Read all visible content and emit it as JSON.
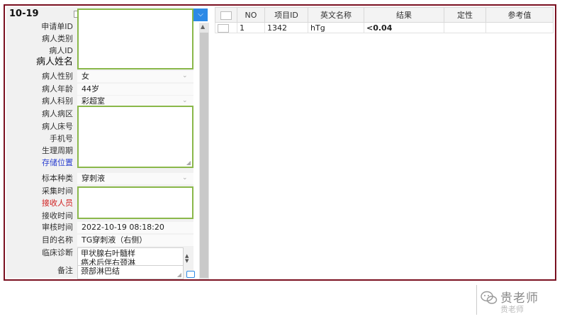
{
  "form": {
    "title": "10-19",
    "labels": {
      "request_id": "申请单ID",
      "patient_type": "病人类别",
      "patient_id": "病人ID",
      "patient_name": "病人姓名",
      "gender": "病人性别",
      "age": "病人年龄",
      "department": "病人科别",
      "ward": "病人病区",
      "bed": "病人床号",
      "phone": "手机号",
      "period": "生理周期",
      "storage": "存储位置",
      "sample_type": "标本种类",
      "collect_time": "采集时间",
      "receiver": "接收人员",
      "receive_time": "接收时间",
      "review_time": "审核时间",
      "purpose": "目的名称",
      "diagnosis": "临床诊断",
      "remark": "备注"
    },
    "values": {
      "gender": "女",
      "age": "44岁",
      "department": "彩超室",
      "sample_type": "穿刺液",
      "review_time": "2022-10-19 08:18:20",
      "purpose": "TG穿刺液（右侧）",
      "diagnosis_line1": "甲状腺右叶髓样",
      "diagnosis_line2": "癌术后伴右颈淋",
      "remark": "颈部淋巴结"
    }
  },
  "results_table": {
    "columns": [
      "NO",
      "项目ID",
      "英文名称",
      "结果",
      "定性",
      "参考值"
    ],
    "rows": [
      {
        "no": "1",
        "item_id": "1342",
        "english_name": "hTg",
        "result": "<0.04",
        "qualitative": "",
        "reference": ""
      }
    ]
  },
  "watermark": {
    "text": "贵老师",
    "sub": "贵老师"
  }
}
